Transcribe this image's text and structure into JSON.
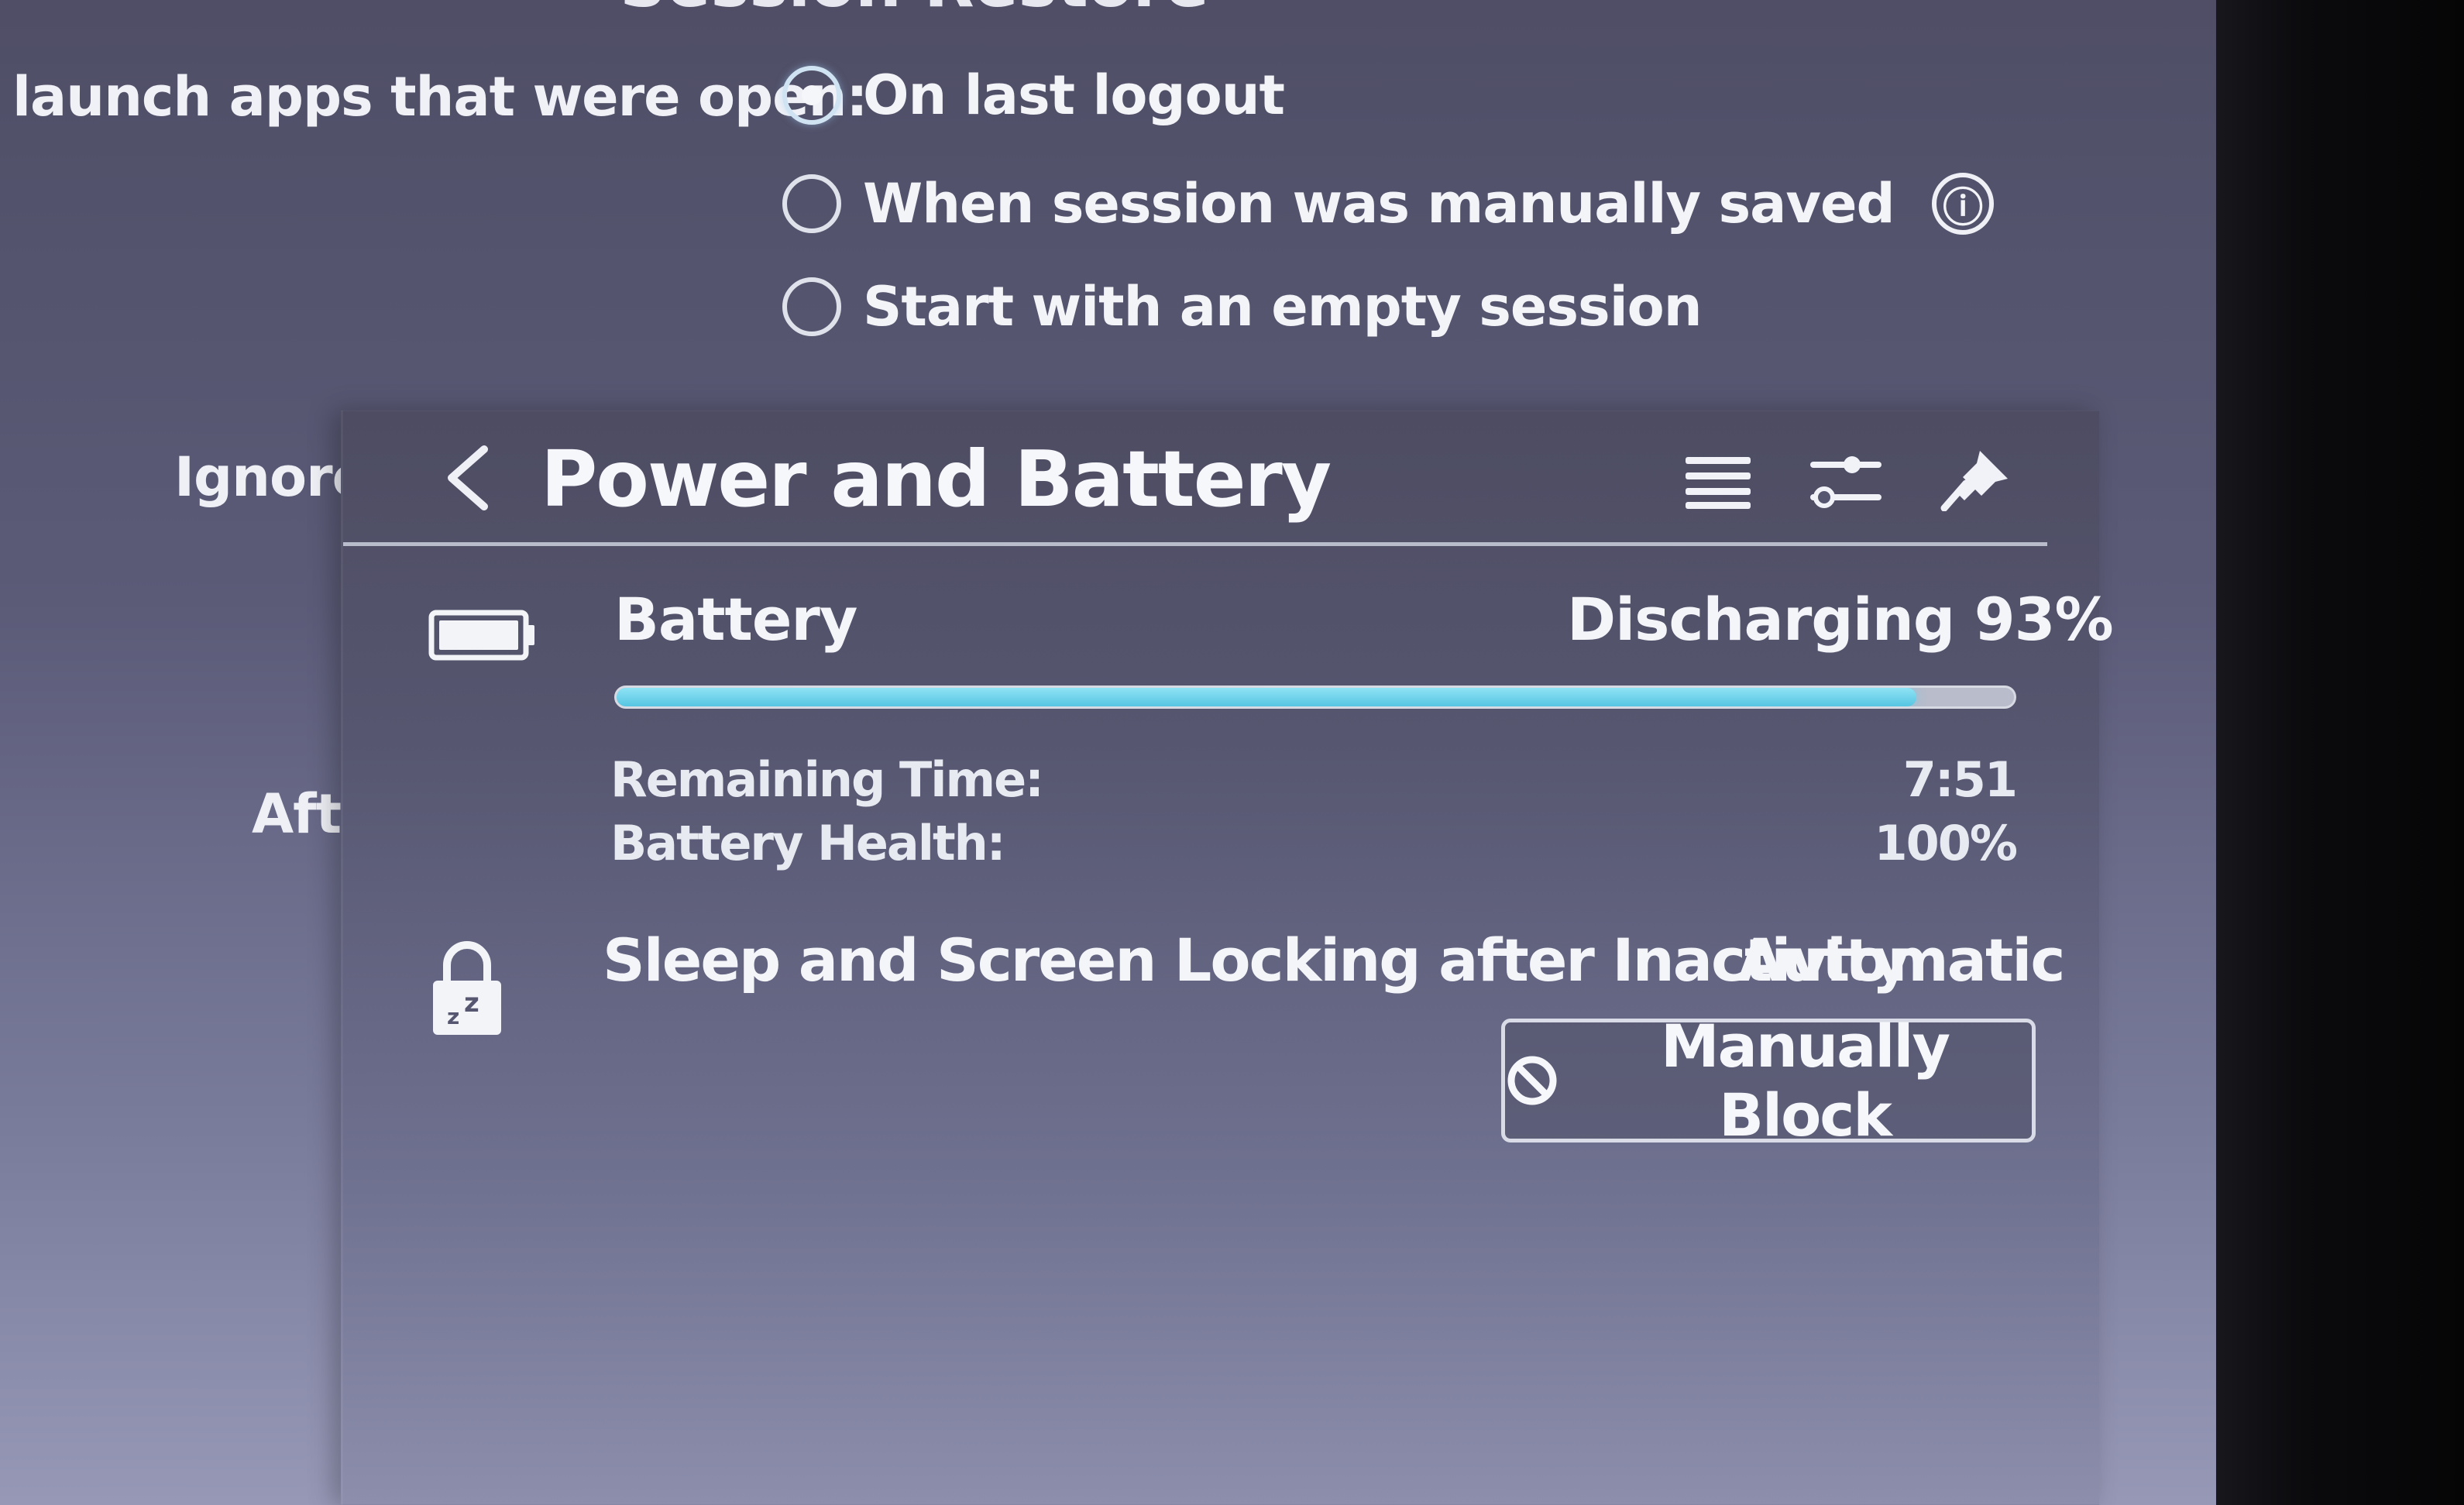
{
  "settings": {
    "heading": "Session Restore",
    "launch_label": "launch apps that were open:",
    "options": [
      {
        "label": "On last logout",
        "checked": true
      },
      {
        "label": "When session was manually saved",
        "checked": false
      },
      {
        "label": "Start with an empty session",
        "checked": false
      }
    ],
    "info_icon": "ⓘ",
    "ignored_label": "Ignored",
    "after_label": "After"
  },
  "panel": {
    "title": "Power and Battery",
    "header_icons": [
      "back-icon",
      "hamburger-menu-icon",
      "configure-icon",
      "pin-icon"
    ],
    "battery": {
      "label": "Battery",
      "status": "Discharging 93%",
      "percent": 93,
      "remaining_label": "Remaining Time:",
      "remaining_value": "7:51",
      "health_label": "Battery Health:",
      "health_value": "100%"
    },
    "inhibit": {
      "label": "Sleep and Screen Locking after Inactivity",
      "value": "Automatic",
      "button_label": "Manually Block"
    }
  },
  "colors": {
    "accent": "#56c5e2",
    "progress_track": "#b8bccb"
  }
}
